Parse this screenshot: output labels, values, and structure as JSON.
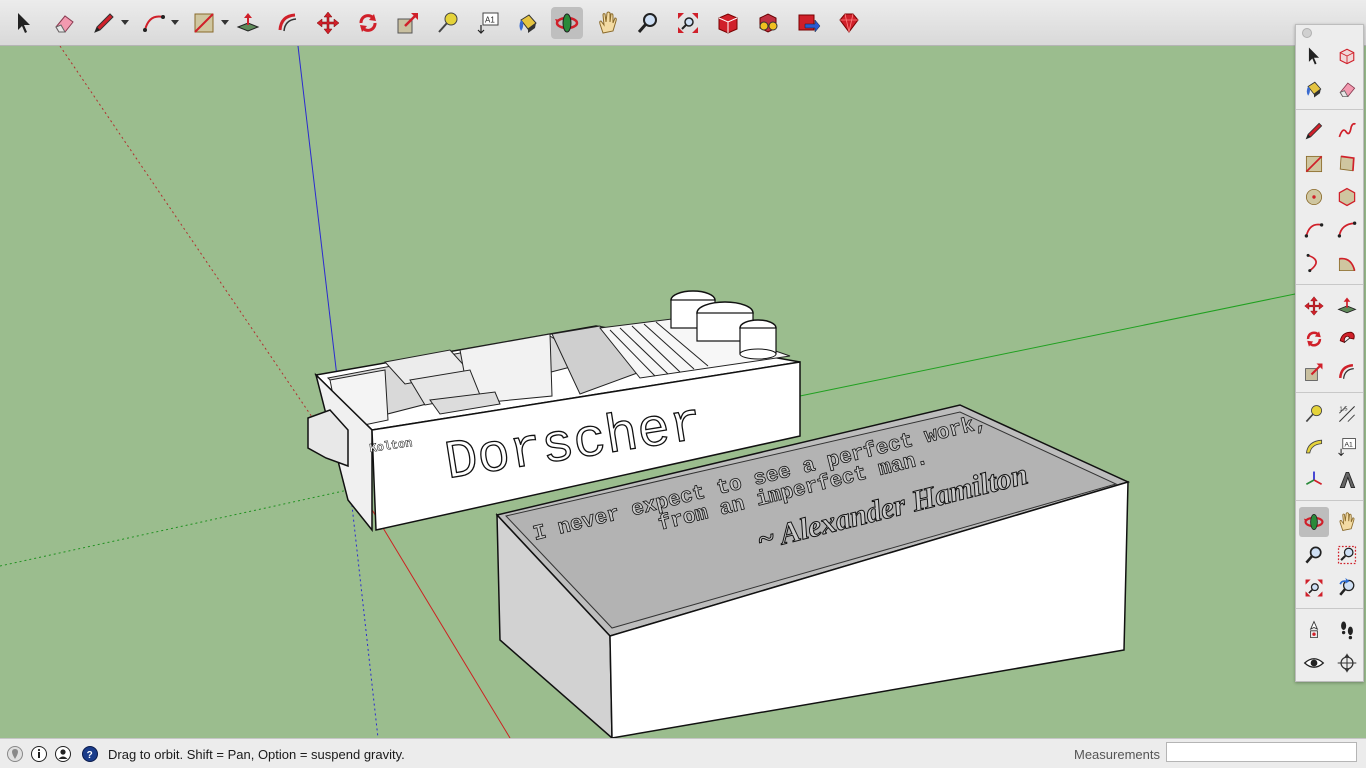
{
  "toolbar": {
    "tools": [
      {
        "name": "select-tool",
        "icon": "arrow-cursor-icon"
      },
      {
        "name": "eraser-tool",
        "icon": "eraser-icon"
      },
      {
        "name": "line-tool",
        "icon": "pencil-icon",
        "dropdown": true
      },
      {
        "name": "arc-tool",
        "icon": "arc-icon",
        "dropdown": true
      },
      {
        "name": "rectangle-tool",
        "icon": "rectangle-icon",
        "dropdown": true
      },
      {
        "name": "push-pull-tool",
        "icon": "push-pull-icon"
      },
      {
        "name": "offset-tool",
        "icon": "offset-icon"
      },
      {
        "name": "move-tool",
        "icon": "move-arrows-icon"
      },
      {
        "name": "rotate-tool",
        "icon": "rotate-icon"
      },
      {
        "name": "scale-tool",
        "icon": "scale-icon"
      },
      {
        "name": "tape-measure-tool",
        "icon": "tape-measure-icon"
      },
      {
        "name": "text-tool",
        "icon": "text-a1-icon"
      },
      {
        "name": "paint-bucket-tool",
        "icon": "paint-bucket-icon"
      },
      {
        "name": "orbit-tool",
        "icon": "orbit-icon",
        "active": true
      },
      {
        "name": "pan-tool",
        "icon": "hand-icon"
      },
      {
        "name": "zoom-tool",
        "icon": "magnifier-icon"
      },
      {
        "name": "zoom-extents-tool",
        "icon": "zoom-extents-icon"
      },
      {
        "name": "3d-warehouse-tool",
        "icon": "warehouse-icon"
      },
      {
        "name": "extension-warehouse-tool",
        "icon": "extension-icon"
      },
      {
        "name": "share-model-tool",
        "icon": "share-icon"
      },
      {
        "name": "ruby-console-tool",
        "icon": "ruby-icon"
      }
    ]
  },
  "palette": {
    "rows": [
      [
        "arrow-cursor-icon",
        "component-icon"
      ],
      [
        "paint-bucket-icon",
        "eraser-icon"
      ],
      [
        "pencil-icon",
        "freehand-icon"
      ],
      [
        "rectangle-icon",
        "rotated-rectangle-icon"
      ],
      [
        "circle-icon",
        "polygon-icon"
      ],
      [
        "arc-icon",
        "two-point-arc-icon"
      ],
      [
        "three-point-arc-icon",
        "pie-icon"
      ],
      [
        "move-arrows-icon",
        "push-pull-icon"
      ],
      [
        "rotate-icon",
        "follow-me-icon"
      ],
      [
        "scale-icon",
        "offset-icon"
      ],
      [
        "tape-measure-icon",
        "dimension-icon"
      ],
      [
        "protractor-icon",
        "text-a1-icon"
      ],
      [
        "axes-icon",
        "3d-text-icon"
      ],
      [
        "orbit-icon",
        "hand-icon"
      ],
      [
        "magnifier-icon",
        "zoom-window-icon"
      ],
      [
        "zoom-extents-icon",
        "previous-view-icon"
      ],
      [
        "position-camera-icon",
        "walk-icon"
      ],
      [
        "look-around-icon",
        "section-plane-icon"
      ]
    ],
    "active": "orbit-icon"
  },
  "model": {
    "box_front_text": "Dorscher",
    "box_side_text": "Kolton",
    "lid_quote_line1": "I never expect to see a perfect work,",
    "lid_quote_line2": "from an imperfect man.",
    "lid_signature": "~ Alexander Hamilton"
  },
  "status": {
    "icons": [
      "geo-location-icon",
      "credits-icon",
      "user-icon",
      "help-icon"
    ],
    "text": "Drag to orbit. Shift = Pan, Option = suspend gravity.",
    "measurements_label": "Measurements",
    "measurements_value": ""
  },
  "colors": {
    "sky_ground": "#9bbd8e",
    "axis_red": "#d02020",
    "axis_green": "#20a020",
    "axis_blue": "#2020c0"
  }
}
